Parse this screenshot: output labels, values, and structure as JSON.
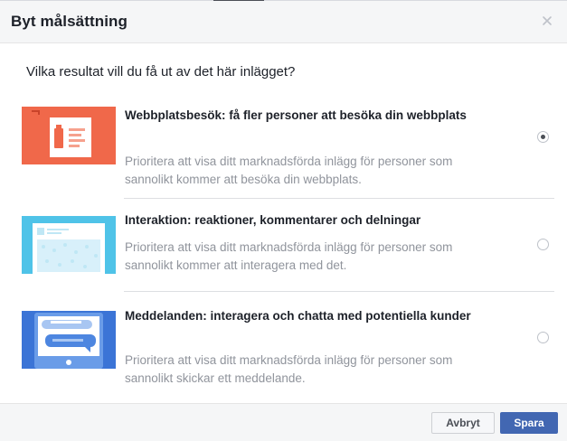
{
  "dialog": {
    "title": "Byt målsättning",
    "close_icon": "close-icon"
  },
  "question": "Vilka resultat vill du få ut av det här inlägget?",
  "options": [
    {
      "title": "Webbplatsbesök: få fler personer att besöka din webbplats",
      "description": "Prioritera att visa ditt marknadsförda inlägg för personer som sannolikt kommer att besöka din webbplats.",
      "selected": true,
      "illustration": "website-visits-illustration",
      "accent_color": "#f0684a"
    },
    {
      "title": "Interaktion: reaktioner, kommentarer och delningar",
      "description": "Prioritera att visa ditt marknadsförda inlägg för personer som sannolikt kommer att interagera med det.",
      "selected": false,
      "illustration": "engagement-illustration",
      "accent_color": "#4fc3e8"
    },
    {
      "title": "Meddelanden: interagera och chatta med potentiella kunder",
      "description": "Prioritera att visa ditt marknadsförda inlägg för personer som sannolikt skickar ett meddelande.",
      "selected": false,
      "illustration": "messages-illustration",
      "accent_color": "#3b74d6"
    }
  ],
  "footer": {
    "cancel_label": "Avbryt",
    "save_label": "Spara"
  },
  "colors": {
    "primary": "#4267b2",
    "header_bg": "#f5f6f7",
    "muted_text": "#90949c"
  }
}
